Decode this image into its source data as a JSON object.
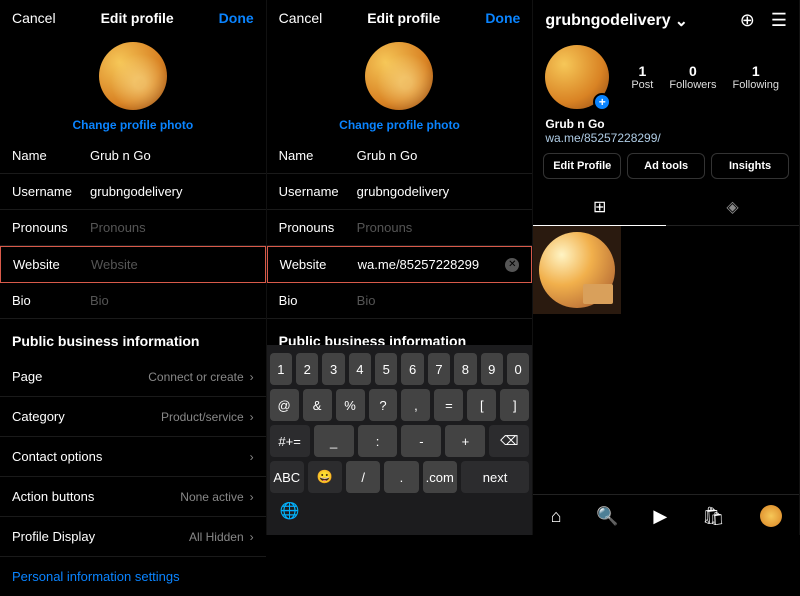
{
  "pane1": {
    "cancel": "Cancel",
    "title": "Edit profile",
    "done": "Done",
    "change_photo": "Change profile photo",
    "fields": {
      "name": {
        "label": "Name",
        "value": "Grub n Go"
      },
      "username": {
        "label": "Username",
        "value": "grubngodelivery"
      },
      "pronouns": {
        "label": "Pronouns",
        "placeholder": "Pronouns"
      },
      "website": {
        "label": "Website",
        "placeholder": "Website"
      },
      "bio": {
        "label": "Bio",
        "placeholder": "Bio"
      }
    },
    "section": "Public business information",
    "list": {
      "page": {
        "label": "Page",
        "sub": "Connect or create"
      },
      "category": {
        "label": "Category",
        "sub": "Product/service"
      },
      "contact": {
        "label": "Contact options",
        "sub": ""
      },
      "action_buttons": {
        "label": "Action buttons",
        "sub": "None active"
      },
      "profile_display": {
        "label": "Profile Display",
        "sub": "All Hidden"
      }
    },
    "personal_info": "Personal information settings"
  },
  "pane2": {
    "cancel": "Cancel",
    "title": "Edit profile",
    "done": "Done",
    "change_photo": "Change profile photo",
    "fields": {
      "name": {
        "label": "Name",
        "value": "Grub n Go"
      },
      "username": {
        "label": "Username",
        "value": "grubngodelivery"
      },
      "pronouns": {
        "label": "Pronouns",
        "placeholder": "Pronouns"
      },
      "website": {
        "label": "Website",
        "value": "wa.me/85257228299"
      },
      "bio": {
        "label": "Bio",
        "placeholder": "Bio"
      }
    },
    "section": "Public business information",
    "keyboard": {
      "r1": [
        "1",
        "2",
        "3",
        "4",
        "5",
        "6",
        "7",
        "8",
        "9",
        "0"
      ],
      "r2": [
        "@",
        "&",
        "%",
        "?",
        ",",
        "=",
        "[",
        "]"
      ],
      "r3": [
        "#+=",
        "_",
        "\\",
        "|",
        "~",
        "<",
        ">",
        "",
        "⌫"
      ],
      "r4": [
        "ABC",
        "😀",
        "/",
        ".",
        ".com",
        "next"
      ],
      "globe": "🌐"
    }
  },
  "pane3": {
    "username": "grubngodelivery",
    "stats": {
      "posts": {
        "num": "1",
        "label": "Post"
      },
      "followers": {
        "num": "0",
        "label": "Followers"
      },
      "following": {
        "num": "1",
        "label": "Following"
      }
    },
    "display_name": "Grub n Go",
    "website": "wa.me/85257228299/",
    "buttons": {
      "edit": "Edit Profile",
      "ads": "Ad tools",
      "insights": "Insights"
    }
  }
}
